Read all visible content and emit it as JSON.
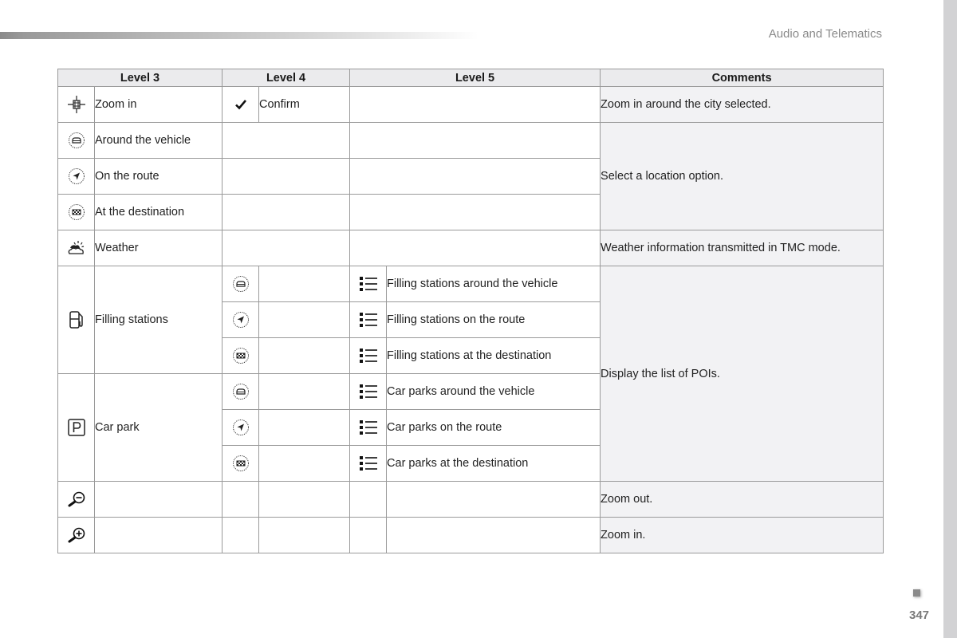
{
  "header": {
    "section_title": "Audio and Telematics"
  },
  "footer": {
    "page_number": "347"
  },
  "table": {
    "columns": [
      "Level 3",
      "Level 4",
      "Level 5",
      "Comments"
    ],
    "rows": {
      "zoom_in_city": {
        "l3_icon": "zoom-target-icon",
        "l3_label": "Zoom in",
        "l4_icon": "checkmark-icon",
        "l4_label": "Confirm",
        "comment": "Zoom in around the city selected."
      },
      "around_vehicle": {
        "l3_icon": "around-vehicle-icon",
        "l3_label": "Around the vehicle"
      },
      "on_route": {
        "l3_icon": "on-route-icon",
        "l3_label": "On the route"
      },
      "at_destination": {
        "l3_icon": "at-destination-icon",
        "l3_label": "At the destination"
      },
      "location_comment": "Select a location option.",
      "weather": {
        "l3_icon": "weather-icon",
        "l3_label": "Weather",
        "comment": "Weather information transmitted in TMC mode."
      },
      "filling": {
        "l3_icon": "fuel-pump-icon",
        "l3_label": "Filling stations",
        "sub": [
          {
            "l4_icon": "around-vehicle-icon",
            "l5_icon": "list-icon",
            "l5_label": "Filling stations around the vehicle"
          },
          {
            "l4_icon": "on-route-icon",
            "l5_icon": "list-icon",
            "l5_label": "Filling stations on the route"
          },
          {
            "l4_icon": "at-destination-icon",
            "l5_icon": "list-icon",
            "l5_label": "Filling stations at the destination"
          }
        ]
      },
      "carpark": {
        "l3_icon": "parking-icon",
        "l3_label": "Car park",
        "sub": [
          {
            "l4_icon": "around-vehicle-icon",
            "l5_icon": "list-icon",
            "l5_label": "Car parks around the vehicle"
          },
          {
            "l4_icon": "on-route-icon",
            "l5_icon": "list-icon",
            "l5_label": "Car parks on the route"
          },
          {
            "l4_icon": "at-destination-icon",
            "l5_icon": "list-icon",
            "l5_label": "Car parks at the destination"
          }
        ]
      },
      "poi_comment": "Display the list of POIs.",
      "zoom_out": {
        "l3_icon": "zoom-out-icon",
        "comment": "Zoom out."
      },
      "zoom_in": {
        "l3_icon": "zoom-in-icon",
        "comment": "Zoom in."
      }
    }
  },
  "colors": {
    "header_bg": "#ebebed",
    "comment_bg": "#f2f2f4",
    "border": "#9a9a9a",
    "side_strip": "#d2d2d4",
    "muted_text": "#8a8a8a"
  }
}
